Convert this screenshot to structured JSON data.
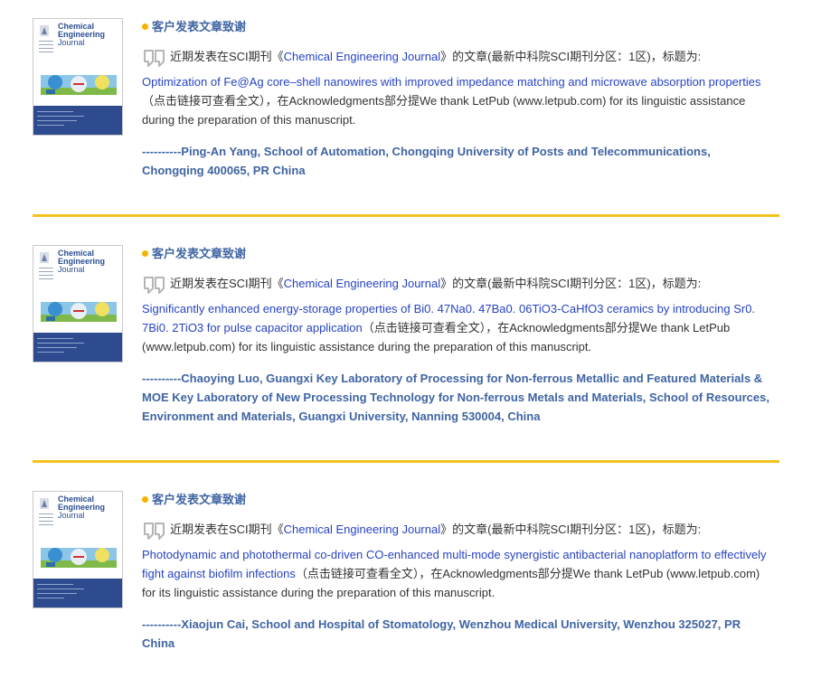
{
  "entries": [
    {
      "heading": "客户发表文章致谢",
      "cover": {
        "line1": "Chemical",
        "line2": "Engineering",
        "line3": "Journal"
      },
      "intro_prefix": "近期发表在SCI期刊《",
      "journal": "Chemical Engineering Journal",
      "intro_suffix": "》的文章(最新中科院SCI期刊分区：1区)，标题为:",
      "title": "Optimization of Fe@Ag core–shell nanowires with improved impedance matching and microwave absorption properties",
      "after_title": "（点击链接可查看全文），在Acknowledgments部分提We thank LetPub (www.letpub.com) for its linguistic assistance during the preparation of this manuscript.",
      "author": "----------Ping-An Yang, School of Automation, Chongqing University of Posts and Telecommunications, Chongqing 400065, PR China"
    },
    {
      "heading": "客户发表文章致谢",
      "cover": {
        "line1": "Chemical",
        "line2": "Engineering",
        "line3": "Journal"
      },
      "intro_prefix": "近期发表在SCI期刊《",
      "journal": "Chemical Engineering Journal",
      "intro_suffix": "》的文章(最新中科院SCI期刊分区：1区)，标题为:",
      "title": "Significantly enhanced energy-storage properties of Bi0. 47Na0. 47Ba0. 06TiO3-CaHfO3 ceramics by introducing Sr0. 7Bi0. 2TiO3 for pulse capacitor application",
      "after_title": "（点击链接可查看全文），在Acknowledgments部分提We thank LetPub (www.letpub.com) for its linguistic assistance during the preparation of this manuscript.",
      "author": "----------Chaoying Luo, Guangxi Key Laboratory of Processing for Non-ferrous Metallic and Featured Materials & MOE Key Laboratory of New Processing Technology for Non-ferrous Metals and Materials, School of Resources, Environment and Materials, Guangxi University, Nanning 530004, China"
    },
    {
      "heading": "客户发表文章致谢",
      "cover": {
        "line1": "Chemical",
        "line2": "Engineering",
        "line3": "Journal"
      },
      "intro_prefix": "近期发表在SCI期刊《",
      "journal": "Chemical Engineering Journal",
      "intro_suffix": "》的文章(最新中科院SCI期刊分区：1区)，标题为:",
      "title": "Photodynamic and photothermal co-driven CO-enhanced multi-mode synergistic antibacterial nanoplatform to effectively fight against biofilm infections",
      "after_title": "（点击链接可查看全文），在Acknowledgments部分提We thank LetPub (www.letpub.com) for its linguistic assistance during the preparation of this manuscript.",
      "author": "----------Xiaojun Cai, School and Hospital of Stomatology, Wenzhou Medical University, Wenzhou 325027, PR China"
    }
  ],
  "colors": {
    "heading": "#3f64a2",
    "link": "#2743c2",
    "divider": "#f5c21b",
    "dot": "#f5b200",
    "cover_band": "#2e4b8f"
  },
  "icons": {
    "quote": "quote-icon",
    "journal_logo": "elsevier-logo-icon"
  }
}
